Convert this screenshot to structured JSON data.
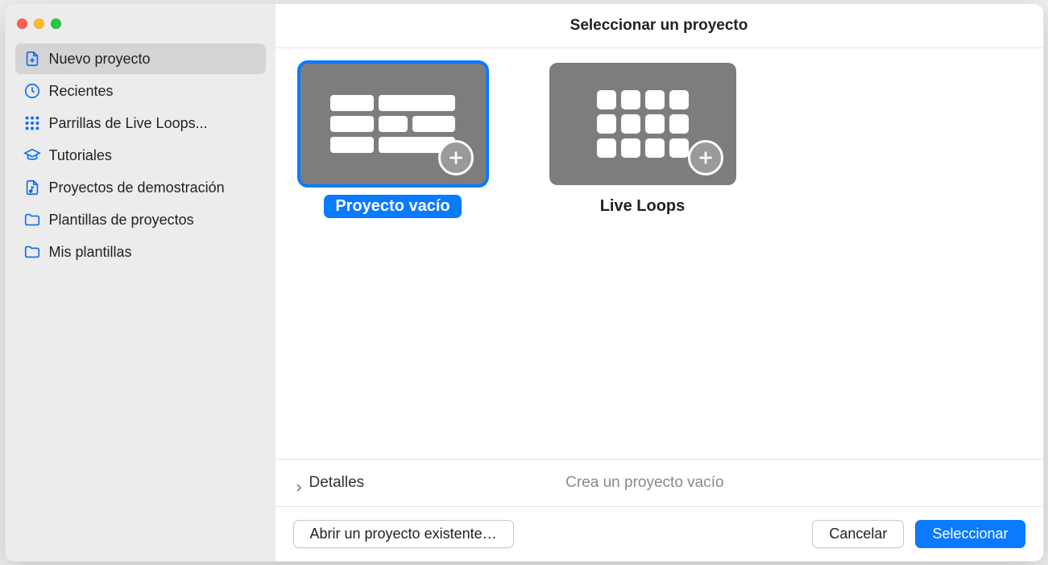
{
  "header": {
    "title": "Seleccionar un proyecto"
  },
  "sidebar": {
    "items": [
      {
        "label": "Nuevo proyecto",
        "icon": "document-new-icon",
        "selected": true
      },
      {
        "label": "Recientes",
        "icon": "clock-icon",
        "selected": false
      },
      {
        "label": "Parrillas de Live Loops...",
        "icon": "grid-icon",
        "selected": false
      },
      {
        "label": "Tutoriales",
        "icon": "graduation-cap-icon",
        "selected": false
      },
      {
        "label": "Proyectos de demostración",
        "icon": "document-music-icon",
        "selected": false
      },
      {
        "label": "Plantillas de proyectos",
        "icon": "folder-icon",
        "selected": false
      },
      {
        "label": "Mis plantillas",
        "icon": "folder-icon",
        "selected": false
      }
    ]
  },
  "templates": [
    {
      "label": "Proyecto vacío",
      "kind": "empty",
      "selected": true
    },
    {
      "label": "Live Loops",
      "kind": "grid",
      "selected": false
    }
  ],
  "details": {
    "toggle_label": "Detalles",
    "description": "Crea un proyecto vacío"
  },
  "footer": {
    "open_existing": "Abrir un proyecto existente…",
    "cancel": "Cancelar",
    "select": "Seleccionar"
  },
  "colors": {
    "accent": "#0a7aff",
    "sidebar_icon": "#0a6cf5",
    "thumb_bg": "#7d7d7d"
  }
}
